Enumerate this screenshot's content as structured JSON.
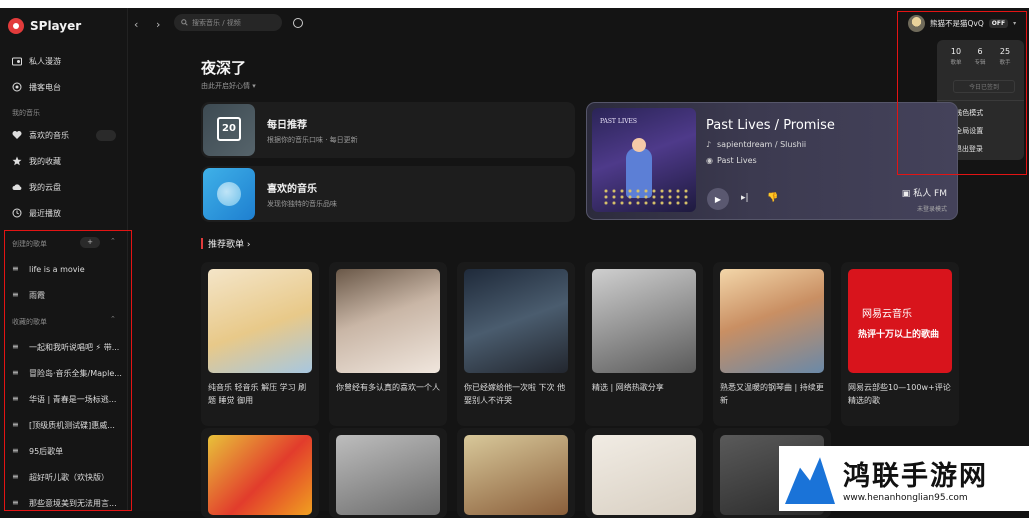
{
  "app": {
    "name": "SPlayer"
  },
  "search": {
    "placeholder": "搜索音乐 / 视频"
  },
  "sidebar": {
    "items": [
      {
        "label": "私人漫游"
      },
      {
        "label": "播客电台"
      }
    ],
    "my_music_title": "我的音乐",
    "my_music": [
      {
        "label": "喜欢的音乐"
      },
      {
        "label": "我的收藏"
      },
      {
        "label": "我的云盘"
      },
      {
        "label": "最近播放"
      }
    ],
    "created_title": "创建的歌单",
    "created": [
      {
        "label": "life is a movie"
      },
      {
        "label": "雨霞"
      }
    ],
    "collected_title": "收藏的歌单",
    "collected": [
      {
        "label": "一起和我听说唱吧 ⚡ 带..."
      },
      {
        "label": "冒险岛·音乐全集/Maple..."
      },
      {
        "label": "华语 | 青春是一场标逃..."
      },
      {
        "label": "[顶级质机测试碟]惠威..."
      },
      {
        "label": "95后歌单"
      },
      {
        "label": "超好听儿歌（欢快版）"
      },
      {
        "label": "那些意境美到无法用言..."
      }
    ]
  },
  "user": {
    "name": "熊猫不是猫QvQ",
    "badge": "OFF",
    "stats": [
      {
        "value": "10",
        "label": "歌单"
      },
      {
        "value": "6",
        "label": "专辑"
      },
      {
        "value": "25",
        "label": "歌手"
      }
    ],
    "signin": "今日已签到",
    "menu": [
      {
        "label": "浅色模式"
      },
      {
        "label": "全局设置"
      },
      {
        "label": "退出登录"
      }
    ]
  },
  "greeting": {
    "title": "夜深了",
    "subtitle": "由此开启好心情"
  },
  "cards": {
    "daily": {
      "title": "每日推荐",
      "subtitle": "根据你的音乐口味 · 每日更新",
      "day": "20"
    },
    "liked": {
      "title": "喜欢的音乐",
      "subtitle": "发现你独特的音乐品味"
    }
  },
  "fm": {
    "title": "Past Lives / Promise",
    "artist": "sapientdream / Slushii",
    "album": "Past Lives",
    "album_art_text": "PAST LIVES",
    "label": "私人 FM",
    "status": "未登录模式"
  },
  "section": {
    "title": "推荐歌单 ›"
  },
  "playlists": [
    {
      "caption": "纯音乐 轻音乐 解压 学习 刷题 睡觉 御用"
    },
    {
      "caption": "你曾经有多认真的喜欢一个人"
    },
    {
      "caption": "你已经嫁给他一次啦 下次 他娶别人不许哭"
    },
    {
      "caption": "精选 | 网络热歌分享"
    },
    {
      "caption": "熟悉又温暖的钢琴曲 | 持续更新"
    },
    {
      "caption": "网易云部些10—100w+评论精选的歌"
    }
  ],
  "promo": {
    "brand": "网易云音乐",
    "text": "热评十万以上的歌曲"
  },
  "watermark": {
    "title": "鸿联手游网",
    "url": "www.henanhonglian95.com"
  },
  "colors": {
    "accent": "#e23b3b",
    "highlight": "#e31414"
  }
}
